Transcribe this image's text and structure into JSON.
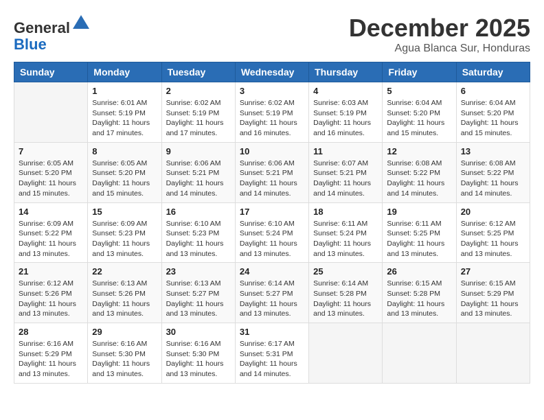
{
  "header": {
    "logo_general": "General",
    "logo_blue": "Blue",
    "month_title": "December 2025",
    "location": "Agua Blanca Sur, Honduras"
  },
  "columns": [
    "Sunday",
    "Monday",
    "Tuesday",
    "Wednesday",
    "Thursday",
    "Friday",
    "Saturday"
  ],
  "weeks": [
    [
      {
        "day": "",
        "sunrise": "",
        "sunset": "",
        "daylight": ""
      },
      {
        "day": "1",
        "sunrise": "Sunrise: 6:01 AM",
        "sunset": "Sunset: 5:19 PM",
        "daylight": "Daylight: 11 hours and 17 minutes."
      },
      {
        "day": "2",
        "sunrise": "Sunrise: 6:02 AM",
        "sunset": "Sunset: 5:19 PM",
        "daylight": "Daylight: 11 hours and 17 minutes."
      },
      {
        "day": "3",
        "sunrise": "Sunrise: 6:02 AM",
        "sunset": "Sunset: 5:19 PM",
        "daylight": "Daylight: 11 hours and 16 minutes."
      },
      {
        "day": "4",
        "sunrise": "Sunrise: 6:03 AM",
        "sunset": "Sunset: 5:19 PM",
        "daylight": "Daylight: 11 hours and 16 minutes."
      },
      {
        "day": "5",
        "sunrise": "Sunrise: 6:04 AM",
        "sunset": "Sunset: 5:20 PM",
        "daylight": "Daylight: 11 hours and 15 minutes."
      },
      {
        "day": "6",
        "sunrise": "Sunrise: 6:04 AM",
        "sunset": "Sunset: 5:20 PM",
        "daylight": "Daylight: 11 hours and 15 minutes."
      }
    ],
    [
      {
        "day": "7",
        "sunrise": "Sunrise: 6:05 AM",
        "sunset": "Sunset: 5:20 PM",
        "daylight": "Daylight: 11 hours and 15 minutes."
      },
      {
        "day": "8",
        "sunrise": "Sunrise: 6:05 AM",
        "sunset": "Sunset: 5:20 PM",
        "daylight": "Daylight: 11 hours and 15 minutes."
      },
      {
        "day": "9",
        "sunrise": "Sunrise: 6:06 AM",
        "sunset": "Sunset: 5:21 PM",
        "daylight": "Daylight: 11 hours and 14 minutes."
      },
      {
        "day": "10",
        "sunrise": "Sunrise: 6:06 AM",
        "sunset": "Sunset: 5:21 PM",
        "daylight": "Daylight: 11 hours and 14 minutes."
      },
      {
        "day": "11",
        "sunrise": "Sunrise: 6:07 AM",
        "sunset": "Sunset: 5:21 PM",
        "daylight": "Daylight: 11 hours and 14 minutes."
      },
      {
        "day": "12",
        "sunrise": "Sunrise: 6:08 AM",
        "sunset": "Sunset: 5:22 PM",
        "daylight": "Daylight: 11 hours and 14 minutes."
      },
      {
        "day": "13",
        "sunrise": "Sunrise: 6:08 AM",
        "sunset": "Sunset: 5:22 PM",
        "daylight": "Daylight: 11 hours and 14 minutes."
      }
    ],
    [
      {
        "day": "14",
        "sunrise": "Sunrise: 6:09 AM",
        "sunset": "Sunset: 5:22 PM",
        "daylight": "Daylight: 11 hours and 13 minutes."
      },
      {
        "day": "15",
        "sunrise": "Sunrise: 6:09 AM",
        "sunset": "Sunset: 5:23 PM",
        "daylight": "Daylight: 11 hours and 13 minutes."
      },
      {
        "day": "16",
        "sunrise": "Sunrise: 6:10 AM",
        "sunset": "Sunset: 5:23 PM",
        "daylight": "Daylight: 11 hours and 13 minutes."
      },
      {
        "day": "17",
        "sunrise": "Sunrise: 6:10 AM",
        "sunset": "Sunset: 5:24 PM",
        "daylight": "Daylight: 11 hours and 13 minutes."
      },
      {
        "day": "18",
        "sunrise": "Sunrise: 6:11 AM",
        "sunset": "Sunset: 5:24 PM",
        "daylight": "Daylight: 11 hours and 13 minutes."
      },
      {
        "day": "19",
        "sunrise": "Sunrise: 6:11 AM",
        "sunset": "Sunset: 5:25 PM",
        "daylight": "Daylight: 11 hours and 13 minutes."
      },
      {
        "day": "20",
        "sunrise": "Sunrise: 6:12 AM",
        "sunset": "Sunset: 5:25 PM",
        "daylight": "Daylight: 11 hours and 13 minutes."
      }
    ],
    [
      {
        "day": "21",
        "sunrise": "Sunrise: 6:12 AM",
        "sunset": "Sunset: 5:26 PM",
        "daylight": "Daylight: 11 hours and 13 minutes."
      },
      {
        "day": "22",
        "sunrise": "Sunrise: 6:13 AM",
        "sunset": "Sunset: 5:26 PM",
        "daylight": "Daylight: 11 hours and 13 minutes."
      },
      {
        "day": "23",
        "sunrise": "Sunrise: 6:13 AM",
        "sunset": "Sunset: 5:27 PM",
        "daylight": "Daylight: 11 hours and 13 minutes."
      },
      {
        "day": "24",
        "sunrise": "Sunrise: 6:14 AM",
        "sunset": "Sunset: 5:27 PM",
        "daylight": "Daylight: 11 hours and 13 minutes."
      },
      {
        "day": "25",
        "sunrise": "Sunrise: 6:14 AM",
        "sunset": "Sunset: 5:28 PM",
        "daylight": "Daylight: 11 hours and 13 minutes."
      },
      {
        "day": "26",
        "sunrise": "Sunrise: 6:15 AM",
        "sunset": "Sunset: 5:28 PM",
        "daylight": "Daylight: 11 hours and 13 minutes."
      },
      {
        "day": "27",
        "sunrise": "Sunrise: 6:15 AM",
        "sunset": "Sunset: 5:29 PM",
        "daylight": "Daylight: 11 hours and 13 minutes."
      }
    ],
    [
      {
        "day": "28",
        "sunrise": "Sunrise: 6:16 AM",
        "sunset": "Sunset: 5:29 PM",
        "daylight": "Daylight: 11 hours and 13 minutes."
      },
      {
        "day": "29",
        "sunrise": "Sunrise: 6:16 AM",
        "sunset": "Sunset: 5:30 PM",
        "daylight": "Daylight: 11 hours and 13 minutes."
      },
      {
        "day": "30",
        "sunrise": "Sunrise: 6:16 AM",
        "sunset": "Sunset: 5:30 PM",
        "daylight": "Daylight: 11 hours and 13 minutes."
      },
      {
        "day": "31",
        "sunrise": "Sunrise: 6:17 AM",
        "sunset": "Sunset: 5:31 PM",
        "daylight": "Daylight: 11 hours and 14 minutes."
      },
      {
        "day": "",
        "sunrise": "",
        "sunset": "",
        "daylight": ""
      },
      {
        "day": "",
        "sunrise": "",
        "sunset": "",
        "daylight": ""
      },
      {
        "day": "",
        "sunrise": "",
        "sunset": "",
        "daylight": ""
      }
    ]
  ]
}
